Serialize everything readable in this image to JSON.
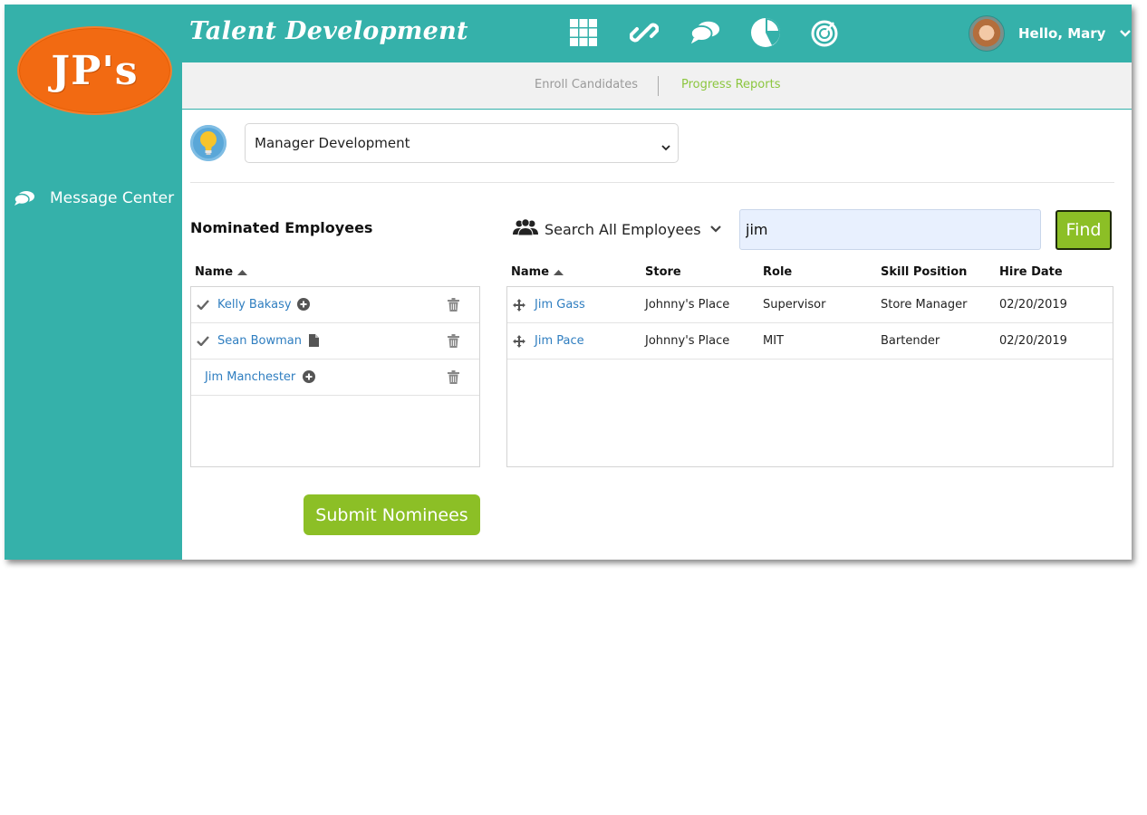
{
  "brand": {
    "logo_text": "JP's"
  },
  "header": {
    "app_title": "Talent Development",
    "icons": [
      "grid-icon",
      "link-icon",
      "chat-icon",
      "pie-chart-icon",
      "target-icon"
    ],
    "user_greeting": "Hello, Mary"
  },
  "sidebar": {
    "items": [
      {
        "label": "Message Center",
        "icon": "chat-icon"
      }
    ]
  },
  "subnav": {
    "tabs": [
      {
        "label": "Enroll Candidates",
        "active": false
      },
      {
        "label": "Progress Reports",
        "active": true
      }
    ]
  },
  "program": {
    "selected": "Manager Development"
  },
  "nominated": {
    "title": "Nominated Employees",
    "column_name": "Name",
    "rows": [
      {
        "name": "Kelly Bakasy",
        "checked": true,
        "status_icon": "plus-circle-icon"
      },
      {
        "name": "Sean Bowman",
        "checked": true,
        "status_icon": "document-icon"
      },
      {
        "name": "Jim Manchester",
        "checked": false,
        "status_icon": "plus-circle-icon"
      }
    ]
  },
  "search": {
    "scope_label": "Search All Employees",
    "query": "jim",
    "find_label": "Find"
  },
  "results": {
    "columns": [
      "Name",
      "Store",
      "Role",
      "Skill Position",
      "Hire Date"
    ],
    "rows": [
      {
        "name": "Jim Gass",
        "store": "Johnny's Place",
        "role": "Supervisor",
        "skill_position": "Store Manager",
        "hire_date": "02/20/2019"
      },
      {
        "name": "Jim Pace",
        "store": "Johnny's Place",
        "role": "MIT",
        "skill_position": "Bartender",
        "hire_date": "02/20/2019"
      }
    ]
  },
  "actions": {
    "submit_label": "Submit Nominees"
  },
  "colors": {
    "teal": "#35b1aa",
    "orange": "#f26a12",
    "green": "#8cbf26",
    "link": "#2f7ec0",
    "active_tab": "#8cc63f"
  }
}
